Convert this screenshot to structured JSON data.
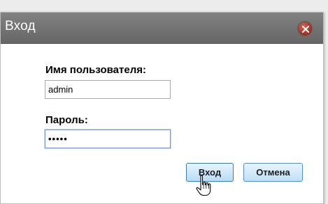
{
  "dialog": {
    "title": "Вход",
    "close_icon": "close-icon",
    "username_label": "Имя пользователя:",
    "username_value": "admin",
    "password_label": "Пароль:",
    "password_value": "•••••",
    "login_button": "Вход",
    "cancel_button": "Отмена"
  },
  "colors": {
    "titlebar": "#747474",
    "close_button": "#9e3a2c",
    "button_border": "#3c7fb1"
  },
  "cursor_icon": "hand-pointer-icon"
}
